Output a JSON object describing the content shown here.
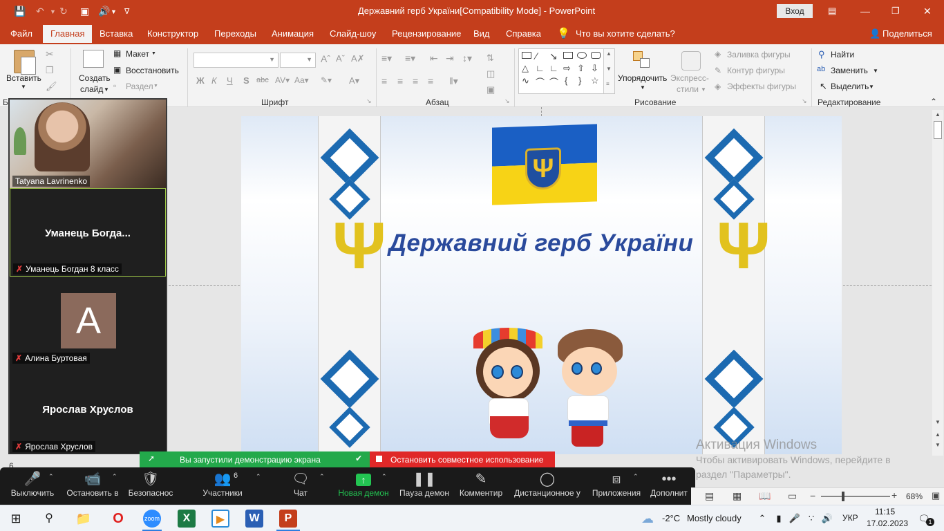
{
  "window": {
    "title": "Державний герб України[Compatibility Mode]  -  PowerPoint",
    "signin": "Вход"
  },
  "tabs": [
    "Файл",
    "Главная",
    "Вставка",
    "Конструктор",
    "Переходы",
    "Анимация",
    "Слайд-шоу",
    "Рецензирование",
    "Вид",
    "Справка"
  ],
  "tellme": "Что вы хотите сделать?",
  "share": "Поделиться",
  "ribbon": {
    "paste": "Вставить",
    "new_slide_1": "Создать",
    "new_slide_2": "слайд",
    "layout": "Макет",
    "reset": "Восстановить",
    "section": "Раздел",
    "font_group": "Шрифт",
    "paragraph_group": "Абзац",
    "drawing_group": "Рисование",
    "editing_group": "Редактирование",
    "arrange": "Упорядочить",
    "quick_styles_1": "Экспресс-",
    "quick_styles_2": "стили",
    "fill": "Заливка фигуры",
    "outline": "Контур фигуры",
    "effects": "Эффекты фигуры",
    "find": "Найти",
    "replace": "Заменить",
    "select": "Выделить",
    "clipboard_short": "Бу"
  },
  "slide": {
    "title": "Державний герб України"
  },
  "zoom_panel": {
    "participants": [
      {
        "name": "Tatyana Lavrinenko",
        "center": "",
        "avatar": ""
      },
      {
        "name": "Уманець Богдан 8 класс",
        "center": "Уманець  Богда...",
        "avatar": ""
      },
      {
        "name": "Алина Буртовая",
        "center": "",
        "avatar": "A"
      },
      {
        "name": "Ярослав Хруслов",
        "center": "Ярослав Хруслов",
        "avatar": ""
      }
    ],
    "slide_num": "6"
  },
  "share_notice": {
    "started": "Вы запустили демонстрацию экрана",
    "stop": "Остановить совместное использование"
  },
  "zoom_toolbar": {
    "mute": "Выключить",
    "video": "Остановить в",
    "security": "Безопаснос",
    "participants": "Участники",
    "participants_count": "6",
    "chat": "Чат",
    "new_share": "Новая демон",
    "pause": "Пауза демон",
    "annotate": "Комментир",
    "remote": "Дистанционное у",
    "apps": "Приложения",
    "more": "Дополнит"
  },
  "watermark": {
    "line1": "Активация Windows",
    "line2": "Чтобы активировать Windows, перейдите в",
    "line3": "раздел \"Параметры\"."
  },
  "statusbar": {
    "zoom": "68%"
  },
  "taskbar": {
    "weather_temp": "-2°C",
    "weather_text": "Mostly cloudy",
    "lang": "УКР",
    "time": "11:15",
    "date": "17.02.2023",
    "notif_count": "1"
  },
  "colors": {
    "ppt_accent": "#c43e1c",
    "slide_title": "#2a4a9c",
    "flag_blue": "#1a5fc4",
    "flag_yellow": "#f7d316",
    "zoom_green": "#23a94b",
    "zoom_red": "#e02828"
  }
}
